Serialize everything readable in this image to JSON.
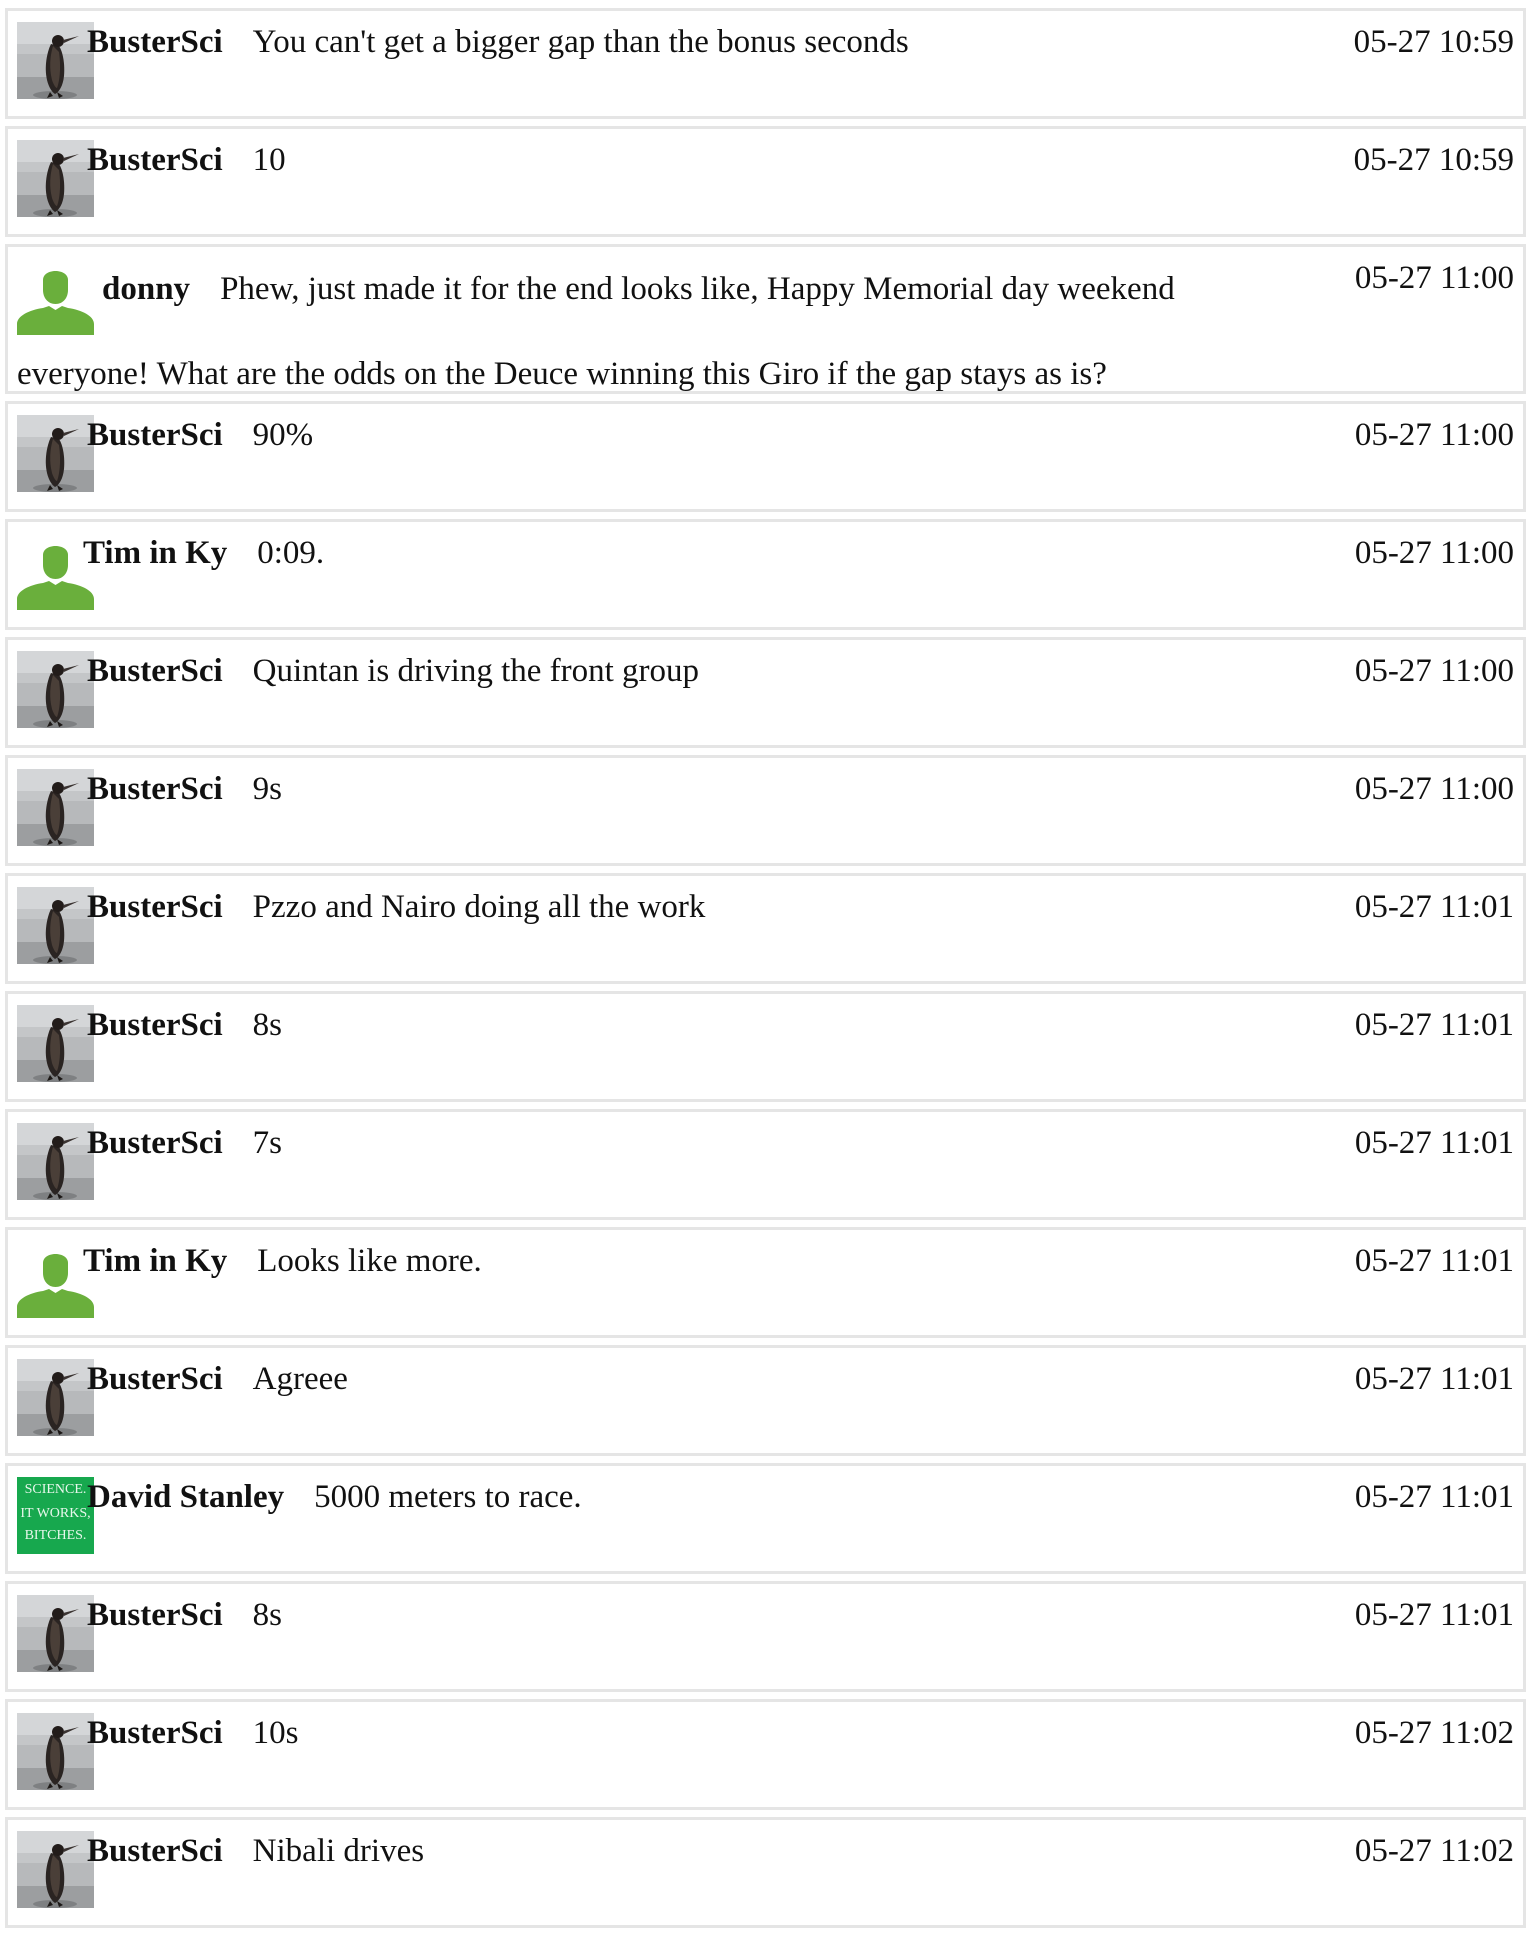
{
  "messages": [
    {
      "user": "BusterSci",
      "text": "You can't get a bigger gap than the bonus seconds",
      "time": "05-27 10:59",
      "avatar": "penguin-photo"
    },
    {
      "user": "BusterSci",
      "text": "10",
      "time": "05-27 10:59",
      "avatar": "penguin-photo"
    },
    {
      "user": "donny",
      "text": "Phew, just made it for the end looks like, Happy Memorial day weekend everyone! What are the odds on the Deuce winning this Giro if the gap stays as is?",
      "time": "05-27 11:00",
      "avatar": "default-person"
    },
    {
      "user": "BusterSci",
      "text": "90%",
      "time": "05-27 11:00",
      "avatar": "penguin-photo"
    },
    {
      "user": "Tim in Ky",
      "text": "0:09.",
      "time": "05-27 11:00",
      "avatar": "default-person"
    },
    {
      "user": "BusterSci",
      "text": "Quintan is driving the front group",
      "time": "05-27 11:00",
      "avatar": "penguin-photo"
    },
    {
      "user": "BusterSci",
      "text": "9s",
      "time": "05-27 11:00",
      "avatar": "penguin-photo"
    },
    {
      "user": "BusterSci",
      "text": "Pzzo and Nairo doing all the work",
      "time": "05-27 11:01",
      "avatar": "penguin-photo"
    },
    {
      "user": "BusterSci",
      "text": "8s",
      "time": "05-27 11:01",
      "avatar": "penguin-photo"
    },
    {
      "user": "BusterSci",
      "text": "7s",
      "time": "05-27 11:01",
      "avatar": "penguin-photo"
    },
    {
      "user": "Tim in Ky",
      "text": "Looks like more.",
      "time": "05-27 11:01",
      "avatar": "default-person"
    },
    {
      "user": "BusterSci",
      "text": "Agreee",
      "time": "05-27 11:01",
      "avatar": "penguin-photo"
    },
    {
      "user": "David Stanley",
      "text": "5000 meters to race.",
      "time": "05-27 11:01",
      "avatar": "science-sign",
      "avatar_text": [
        "SCIENCE.",
        "IT WORKS,",
        "BITCHES."
      ]
    },
    {
      "user": "BusterSci",
      "text": "8s",
      "time": "05-27 11:01",
      "avatar": "penguin-photo"
    },
    {
      "user": "BusterSci",
      "text": "10s",
      "time": "05-27 11:02",
      "avatar": "penguin-photo"
    },
    {
      "user": "BusterSci",
      "text": "Nibali drives",
      "time": "05-27 11:02",
      "avatar": "penguin-photo"
    }
  ],
  "colors": {
    "border": "#e5e5e5",
    "person_avatar": "#6aaf3c",
    "science_avatar": "#17a84e"
  }
}
